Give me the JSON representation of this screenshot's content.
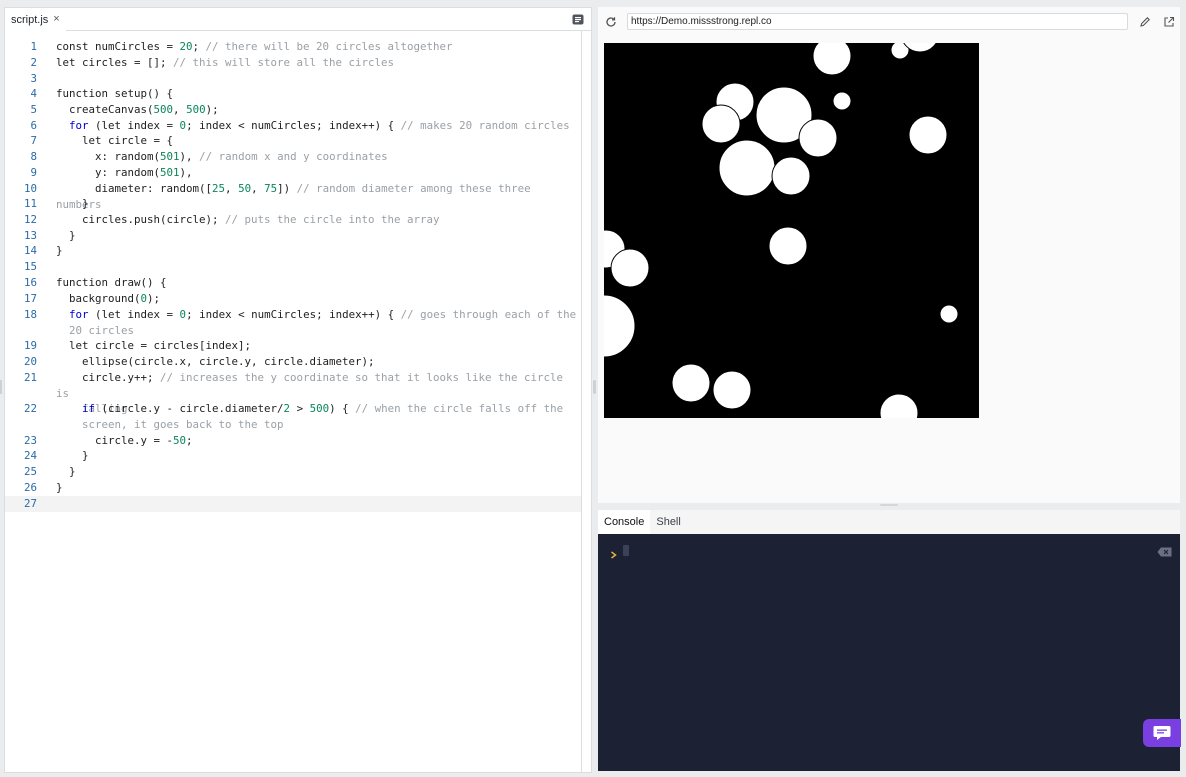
{
  "editor": {
    "tab_label": "script.js",
    "close_glyph": "×",
    "lines": [
      {
        "n": "1",
        "html": "const numCircles = <span class=\"c-num\">20</span>; <span class=\"c-com\">// there will be 20 circles altogether</span>"
      },
      {
        "n": "2",
        "html": "let circles = []; <span class=\"c-com\">// this will store all the circles</span>"
      },
      {
        "n": "3",
        "html": ""
      },
      {
        "n": "4",
        "html": "function setup() {"
      },
      {
        "n": "5",
        "html": "  createCanvas(<span class=\"c-num\">500</span>, <span class=\"c-num\">500</span>);"
      },
      {
        "n": "6",
        "html": "  <span class=\"c-kw\">for</span> (let index = <span class=\"c-num\">0</span>; index &lt; numCircles; index++) { <span class=\"c-com\">// makes 20 random circles</span>"
      },
      {
        "n": "7",
        "html": "    let circle = {"
      },
      {
        "n": "8",
        "html": "      x: random(<span class=\"c-num\">501</span>), <span class=\"c-com\">// random x and y coordinates</span>"
      },
      {
        "n": "9",
        "html": "      y: random(<span class=\"c-num\">501</span>),"
      },
      {
        "n": "10",
        "html": "      diameter: random([<span class=\"c-num\">25</span>, <span class=\"c-num\">50</span>, <span class=\"c-num\">75</span>]) <span class=\"c-com\">// random diameter among these three numbers</span>"
      },
      {
        "n": "11",
        "html": "    }"
      },
      {
        "n": "12",
        "html": "    circles.push(circle); <span class=\"c-com\">// puts the circle into the array</span>"
      },
      {
        "n": "13",
        "html": "  }"
      },
      {
        "n": "14",
        "html": "}"
      },
      {
        "n": "15",
        "html": ""
      },
      {
        "n": "16",
        "html": "function draw() {"
      },
      {
        "n": "17",
        "html": "  background(<span class=\"c-num\">0</span>);"
      },
      {
        "n": "18",
        "html": "  <span class=\"c-kw\">for</span> (let index = <span class=\"c-num\">0</span>; index &lt; numCircles; index++) { <span class=\"c-com\">// goes through each of the</span>\n  <span class=\"c-com\">20 circles</span>"
      },
      {
        "n": "19",
        "html": "  let circle = circles[index];"
      },
      {
        "n": "20",
        "html": "    ellipse(circle.x, circle.y, circle.diameter);"
      },
      {
        "n": "21",
        "html": "    circle.y++; <span class=\"c-com\">// increases the y coordinate so that it looks like the circle is</span>\n    <span class=\"c-com\">falling</span>"
      },
      {
        "n": "22",
        "html": "    <span class=\"c-kw\">if</span> (circle.y - circle.diameter/<span class=\"c-num\">2</span> &gt; <span class=\"c-num\">500</span>) { <span class=\"c-com\">// when the circle falls off the</span>\n    <span class=\"c-com\">screen, it goes back to the top</span>"
      },
      {
        "n": "23",
        "html": "      circle.y = -<span class=\"c-num\">50</span>;"
      },
      {
        "n": "24",
        "html": "    }"
      },
      {
        "n": "25",
        "html": "  }"
      },
      {
        "n": "26",
        "html": "}"
      },
      {
        "n": "27",
        "html": ""
      }
    ]
  },
  "webview": {
    "url": "https://Demo.missstrong.repl.co",
    "canvas_background": "#000000",
    "circle_color": "#ffffff"
  },
  "console": {
    "tabs": [
      "Console",
      "Shell"
    ],
    "active_tab": "Console",
    "background": "#1c2233",
    "prompt_color": "#e3b341"
  },
  "chat_button": {
    "icon": "chat-bubble-icon",
    "color": "#7a3fe0"
  }
}
